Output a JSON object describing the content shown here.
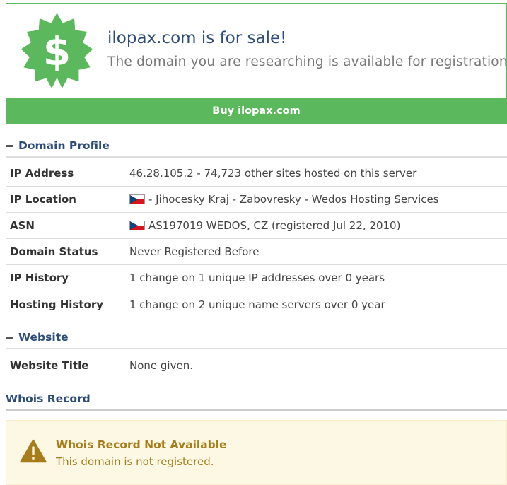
{
  "sale": {
    "title": "ilopax.com is for sale!",
    "subtitle": "The domain you are researching is available for registration.",
    "badge_symbol": "$",
    "badge_icon": "dollar-badge-icon",
    "buy_label": "Buy ilopax.com"
  },
  "domain_profile": {
    "title": "Domain Profile",
    "rows": [
      {
        "label": "IP Address",
        "value": "46.28.105.2 - 74,723 other sites hosted on this server"
      },
      {
        "label": "IP Location",
        "value": "- Jihocesky Kraj - Zabovresky - Wedos Hosting Services",
        "flag": "czech-flag-icon"
      },
      {
        "label": "ASN",
        "value": "AS197019 WEDOS, CZ (registered Jul 22, 2010)",
        "flag": "czech-flag-icon"
      },
      {
        "label": "Domain Status",
        "value": "Never Registered Before"
      },
      {
        "label": "IP History",
        "value": "1 change on 1 unique IP addresses over 0 years"
      },
      {
        "label": "Hosting History",
        "value": "1 change on 2 unique name servers over 0 year"
      }
    ]
  },
  "website": {
    "title": "Website",
    "rows": [
      {
        "label": "Website Title",
        "value": "None given."
      }
    ]
  },
  "whois": {
    "title": "Whois Record",
    "alert_title": "Whois Record Not Available",
    "alert_text": "This domain is not registered.",
    "alert_icon": "warning-icon"
  },
  "colors": {
    "accent_green": "#5cb85c",
    "heading_blue": "#2d4d78",
    "warning_text": "#a67d1a",
    "warning_bg": "#fcf8e3"
  }
}
